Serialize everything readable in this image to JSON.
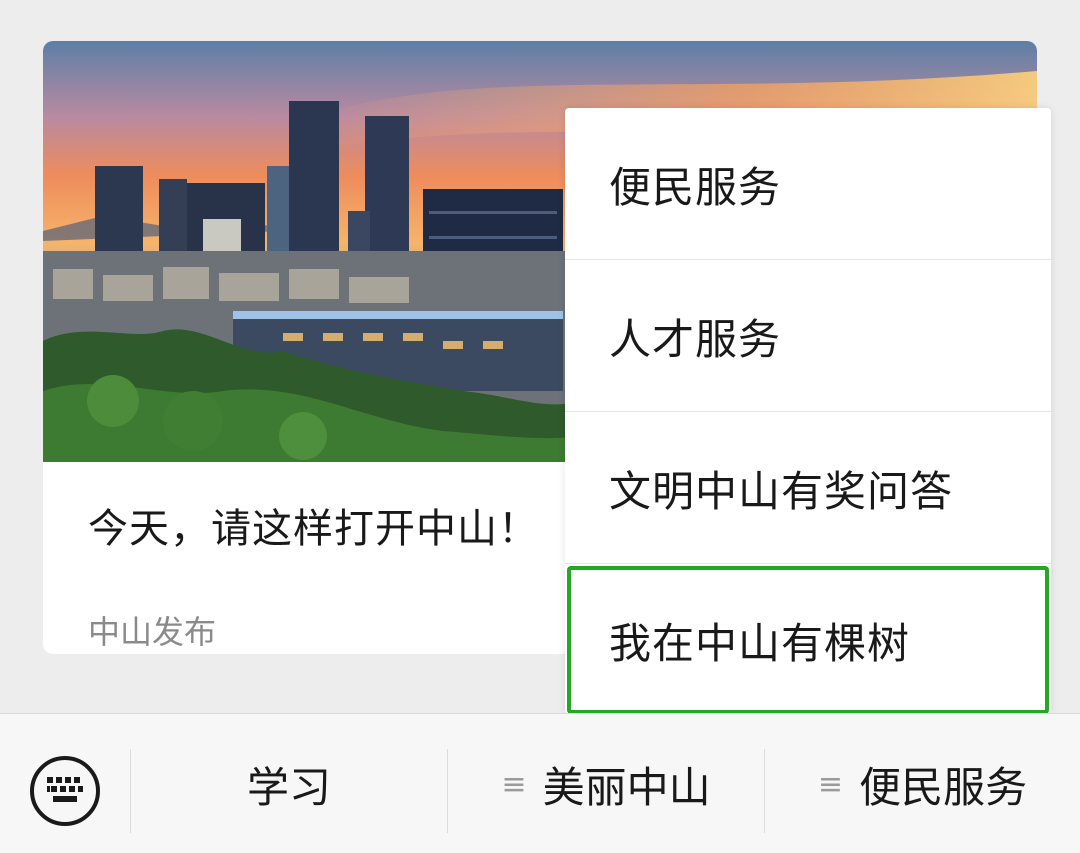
{
  "article": {
    "title": "今天，请这样打开中山！",
    "source": "中山发布"
  },
  "popup_menu": {
    "items": [
      {
        "label": "便民服务"
      },
      {
        "label": "人才服务"
      },
      {
        "label": "文明中山有奖问答"
      },
      {
        "label": "我在中山有棵树",
        "selected": true
      }
    ]
  },
  "bottom_bar": {
    "keyboard_icon": "keyboard-icon",
    "tabs": [
      {
        "label": "学习",
        "has_submenu": false
      },
      {
        "label": "美丽中山",
        "has_submenu": true,
        "icon": "hamburger-icon"
      },
      {
        "label": "便民服务",
        "has_submenu": true,
        "icon": "hamburger-icon"
      }
    ]
  },
  "colors": {
    "highlight_border": "#23a823",
    "background": "#ededed",
    "text_primary": "#191919",
    "text_secondary": "#8a8a8a"
  }
}
